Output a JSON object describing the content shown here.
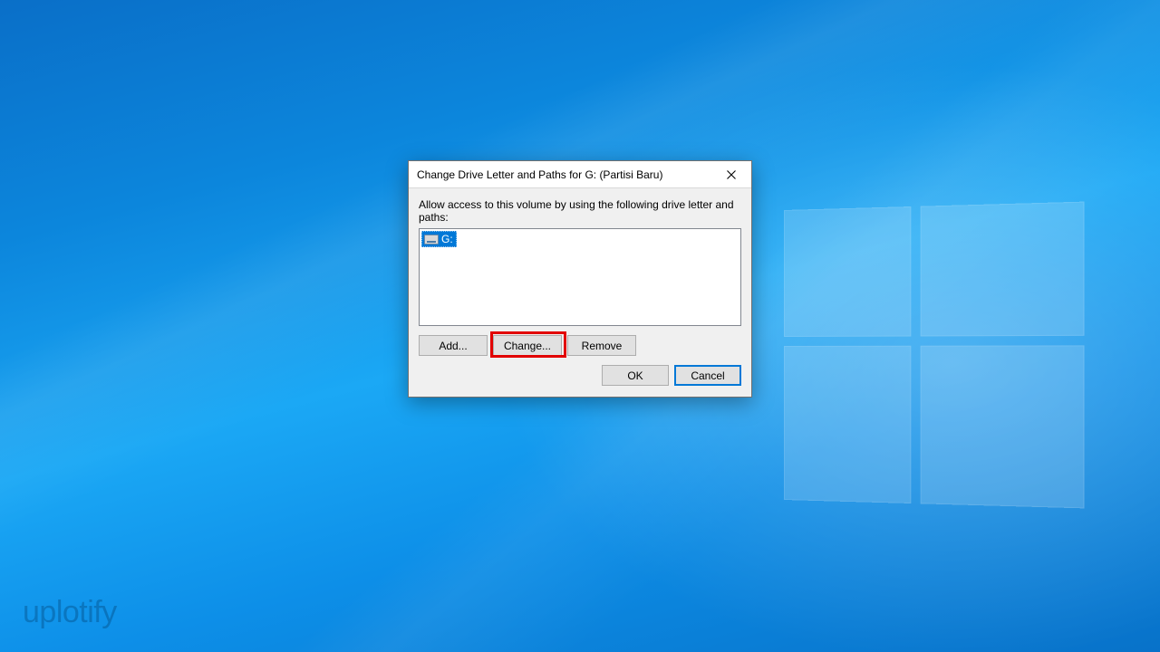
{
  "dialog": {
    "title": "Change Drive Letter and Paths for G: (Partisi Baru)",
    "instruction": "Allow access to this volume by using the following drive letter and paths:",
    "list": {
      "items": [
        {
          "label": "G:"
        }
      ]
    },
    "buttons": {
      "add": "Add...",
      "change": "Change...",
      "remove": "Remove",
      "ok": "OK",
      "cancel": "Cancel"
    }
  },
  "watermark": "uplotify"
}
